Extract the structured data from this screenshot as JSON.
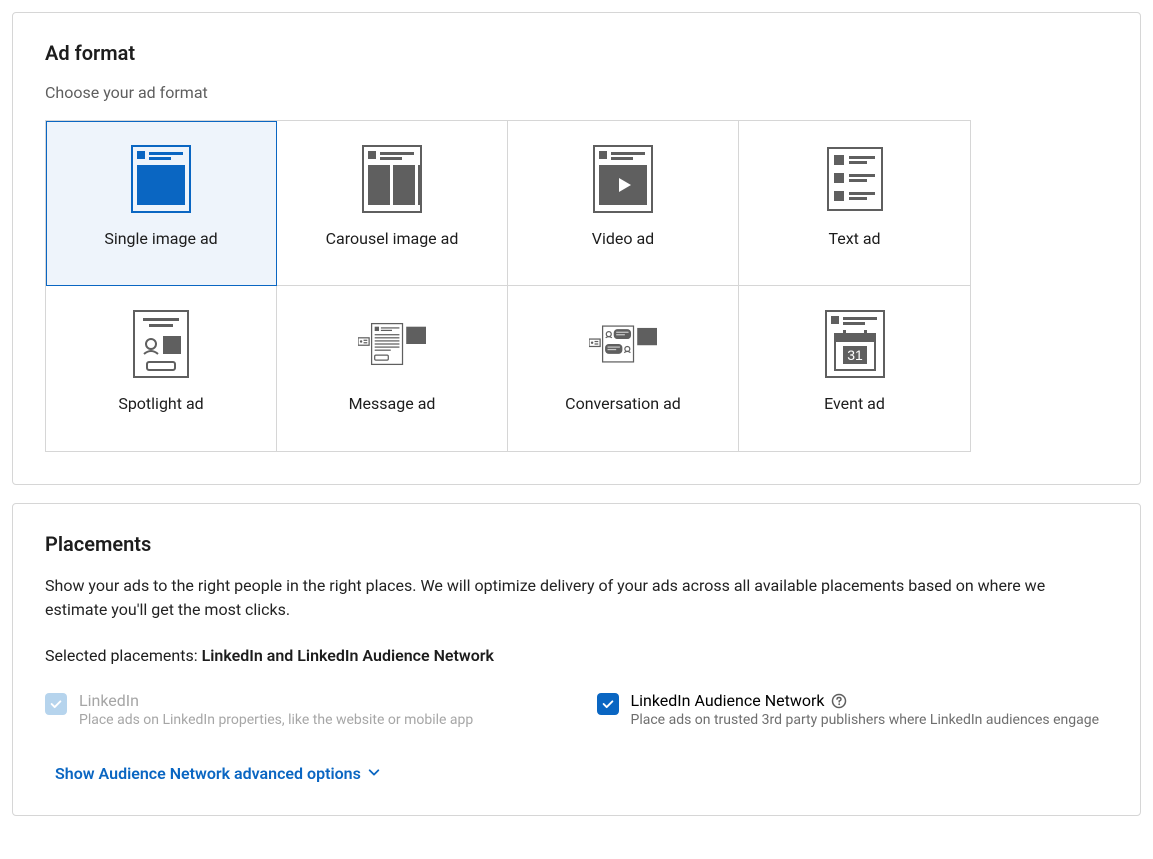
{
  "ad_format": {
    "title": "Ad format",
    "subtitle": "Choose your ad format",
    "options": [
      {
        "label": "Single image ad",
        "selected": true
      },
      {
        "label": "Carousel image ad",
        "selected": false
      },
      {
        "label": "Video ad",
        "selected": false
      },
      {
        "label": "Text ad",
        "selected": false
      },
      {
        "label": "Spotlight ad",
        "selected": false
      },
      {
        "label": "Message ad",
        "selected": false
      },
      {
        "label": "Conversation ad",
        "selected": false
      },
      {
        "label": "Event ad",
        "selected": false
      }
    ]
  },
  "placements": {
    "title": "Placements",
    "description": "Show your ads to the right people in the right places. We will optimize delivery of your ads across all available placements based on where we estimate you'll get the most clicks.",
    "selected_prefix": "Selected placements: ",
    "selected_value": "LinkedIn and LinkedIn Audience Network",
    "items": [
      {
        "label": "LinkedIn",
        "desc": "Place ads on LinkedIn properties, like the website or mobile app",
        "checked": true,
        "disabled": true
      },
      {
        "label": "LinkedIn Audience Network",
        "desc": "Place ads on trusted 3rd party publishers where LinkedIn audiences engage",
        "checked": true,
        "disabled": false,
        "help": true
      }
    ],
    "advanced_link": "Show Audience Network advanced options"
  }
}
